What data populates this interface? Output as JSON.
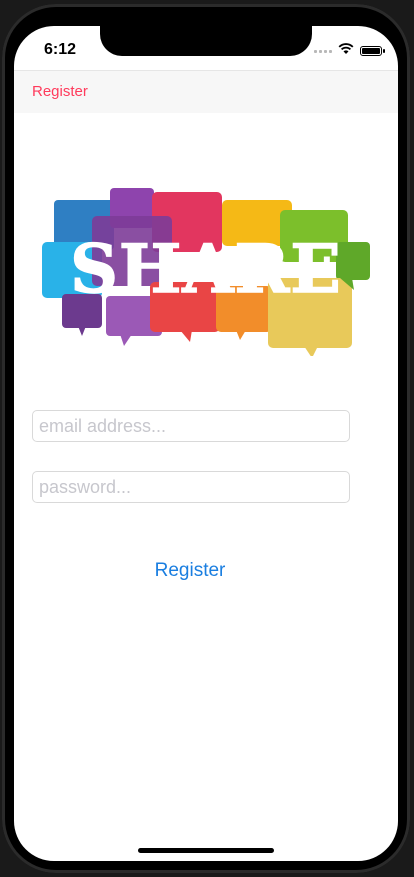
{
  "status_bar": {
    "time": "6:12",
    "icons": [
      "cellular-signal-icon",
      "wifi-icon",
      "battery-icon"
    ]
  },
  "navbar": {
    "title": "Register"
  },
  "logo": {
    "text": "SHARE",
    "bubble_colors": [
      "#2f7fc3",
      "#8e44ad",
      "#e2365f",
      "#f5b916",
      "#7cbf2b",
      "#29b2e8",
      "#f28d2a",
      "#e94545"
    ]
  },
  "form": {
    "email_placeholder": "email address...",
    "email_value": "",
    "password_placeholder": "password...",
    "password_value": "",
    "register_label": "Register"
  },
  "colors": {
    "accent_blue": "#1a7ee0",
    "nav_title_red": "#ff3b5c"
  }
}
